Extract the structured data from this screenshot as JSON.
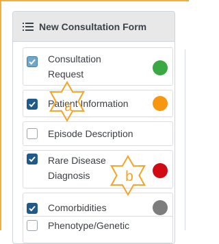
{
  "form": {
    "title": "New Consultation Form",
    "header_icon": "list-icon",
    "items": [
      {
        "label": "Consultation\nRequest",
        "state": "checked-disabled",
        "status_color": "#3aa843"
      },
      {
        "label": "Patient Information",
        "state": "checked",
        "status_color": "#f7960f"
      },
      {
        "label": "Episode Description",
        "state": "unchecked",
        "status_color": ""
      },
      {
        "label": "Rare Disease\nDiagnosis",
        "state": "checked",
        "status_color": "#d10a14"
      },
      {
        "label": "Comorbidities",
        "state": "checked",
        "status_color": "#7d7d7d"
      },
      {
        "label": "Phenotype/Genetic",
        "state": "unchecked",
        "status_color": ""
      }
    ]
  },
  "annotations": [
    {
      "letter": "a",
      "color": "#f6a322"
    },
    {
      "letter": "b",
      "color": "#f6a322"
    }
  ]
}
